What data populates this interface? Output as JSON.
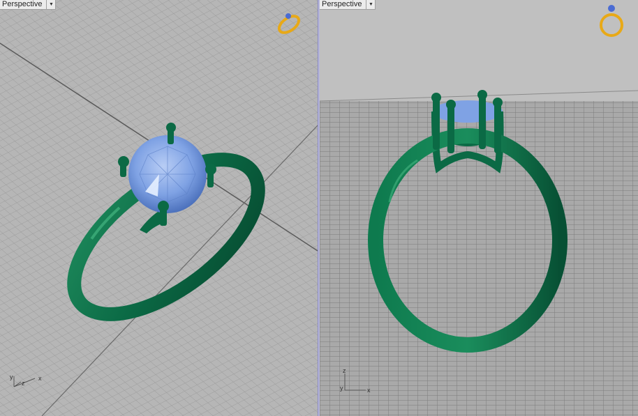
{
  "viewports": [
    {
      "id": "left",
      "title": "Perspective",
      "menu_icon": "triangle-down-icon",
      "axes": {
        "x": "x",
        "y": "y",
        "z": "z"
      }
    },
    {
      "id": "right",
      "title": "Perspective",
      "menu_icon": "triangle-down-icon",
      "axes": {
        "x": "x",
        "y": "y",
        "z": "z"
      }
    }
  ],
  "colors": {
    "metal": "#0b6a45",
    "metal_highlight": "#3fae7a",
    "gem": "#7fa2e4",
    "grid_bg": "#b4b4b4",
    "floor_bg": "#a9a9a9",
    "sky": "#c0c0c0",
    "nav_widget": "#e8a917"
  }
}
